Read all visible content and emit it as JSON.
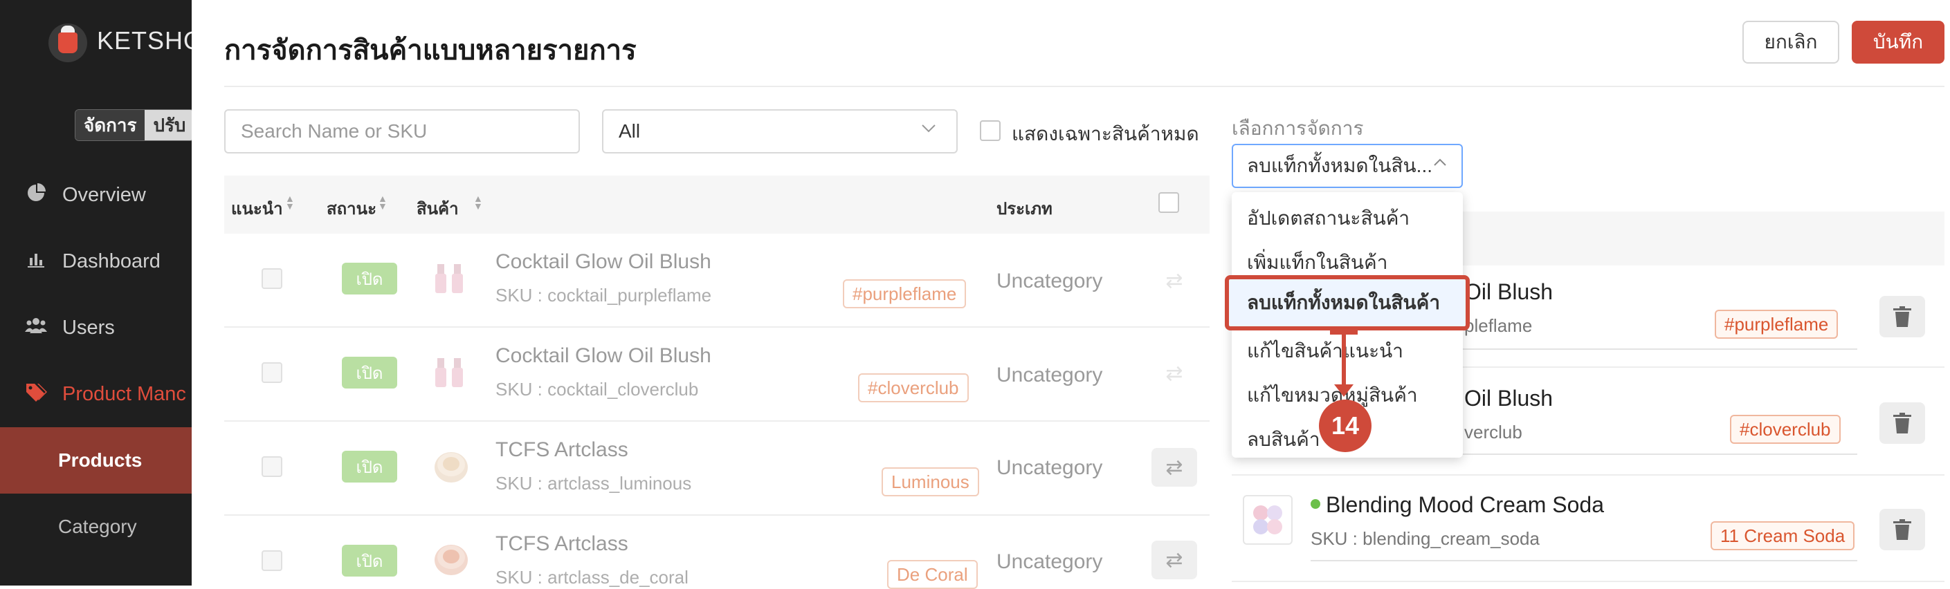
{
  "sidebar": {
    "brand": "KETSHO",
    "mode_active": "จัดการ",
    "mode_inactive": "ปรับ",
    "items": [
      {
        "label": "Overview",
        "icon": "pie-chart-icon"
      },
      {
        "label": "Dashboard",
        "icon": "bar-chart-icon"
      },
      {
        "label": "Users",
        "icon": "users-icon"
      },
      {
        "label": "Product Manc",
        "icon": "tag-icon"
      }
    ],
    "subitems": [
      {
        "label": "Products"
      },
      {
        "label": "Category"
      }
    ]
  },
  "header": {
    "title": "การจัดการสินค้าแบบหลายรายการ",
    "cancel_label": "ยกเลิก",
    "save_label": "บันทึก"
  },
  "filters": {
    "search_placeholder": "Search Name or SKU",
    "select_value": "All",
    "outofstock_label": "แสดงเฉพาะสินค้าหมด"
  },
  "table": {
    "columns": [
      "แนะนำ",
      "สถานะ",
      "สินค้า",
      "ประเภท"
    ],
    "rows": [
      {
        "status": "เปิด",
        "name": "Cocktail Glow Oil Blush",
        "sku": "SKU : cocktail_purpleflame",
        "tag": "#purpleflame",
        "type": "Uncategory"
      },
      {
        "status": "เปิด",
        "name": "Cocktail Glow Oil Blush",
        "sku": "SKU : cocktail_cloverclub",
        "tag": "#cloverclub",
        "type": "Uncategory"
      },
      {
        "status": "เปิด",
        "name": "TCFS Artclass",
        "sku": "SKU : artclass_luminous",
        "tag": "Luminous",
        "type": "Uncategory"
      },
      {
        "status": "เปิด",
        "name": "TCFS Artclass",
        "sku": "SKU : artclass_de_coral",
        "tag": "De Coral",
        "type": "Uncategory"
      }
    ]
  },
  "action_panel": {
    "label": "เลือกการจัดการ",
    "selected": "ลบแท็กทั้งหมดในสิน...",
    "options": [
      "อัปเดตสถานะสินค้า",
      "เพิ่มแท็กในสินค้า",
      "ลบแท็กทั้งหมดในสินค้า",
      "แก้ไขสินค้าแนะนำ",
      "แก้ไขหมวดหมู่สินค้า",
      "ลบสินค้า"
    ],
    "items": [
      {
        "name": "Oil Blush",
        "sku": "pleflame",
        "tag": "#purpleflame"
      },
      {
        "name": "Oil Blush",
        "sku": "verclub",
        "tag": "#cloverclub"
      },
      {
        "name": "Blending Mood Cream Soda",
        "sku": "SKU : blending_cream_soda",
        "tag": "11 Cream Soda"
      }
    ]
  },
  "annotation": {
    "step": "14"
  },
  "colors": {
    "accent": "#cf4a3a",
    "status_green": "#b9dfa2",
    "in_stock_dot": "#6cc04a"
  }
}
